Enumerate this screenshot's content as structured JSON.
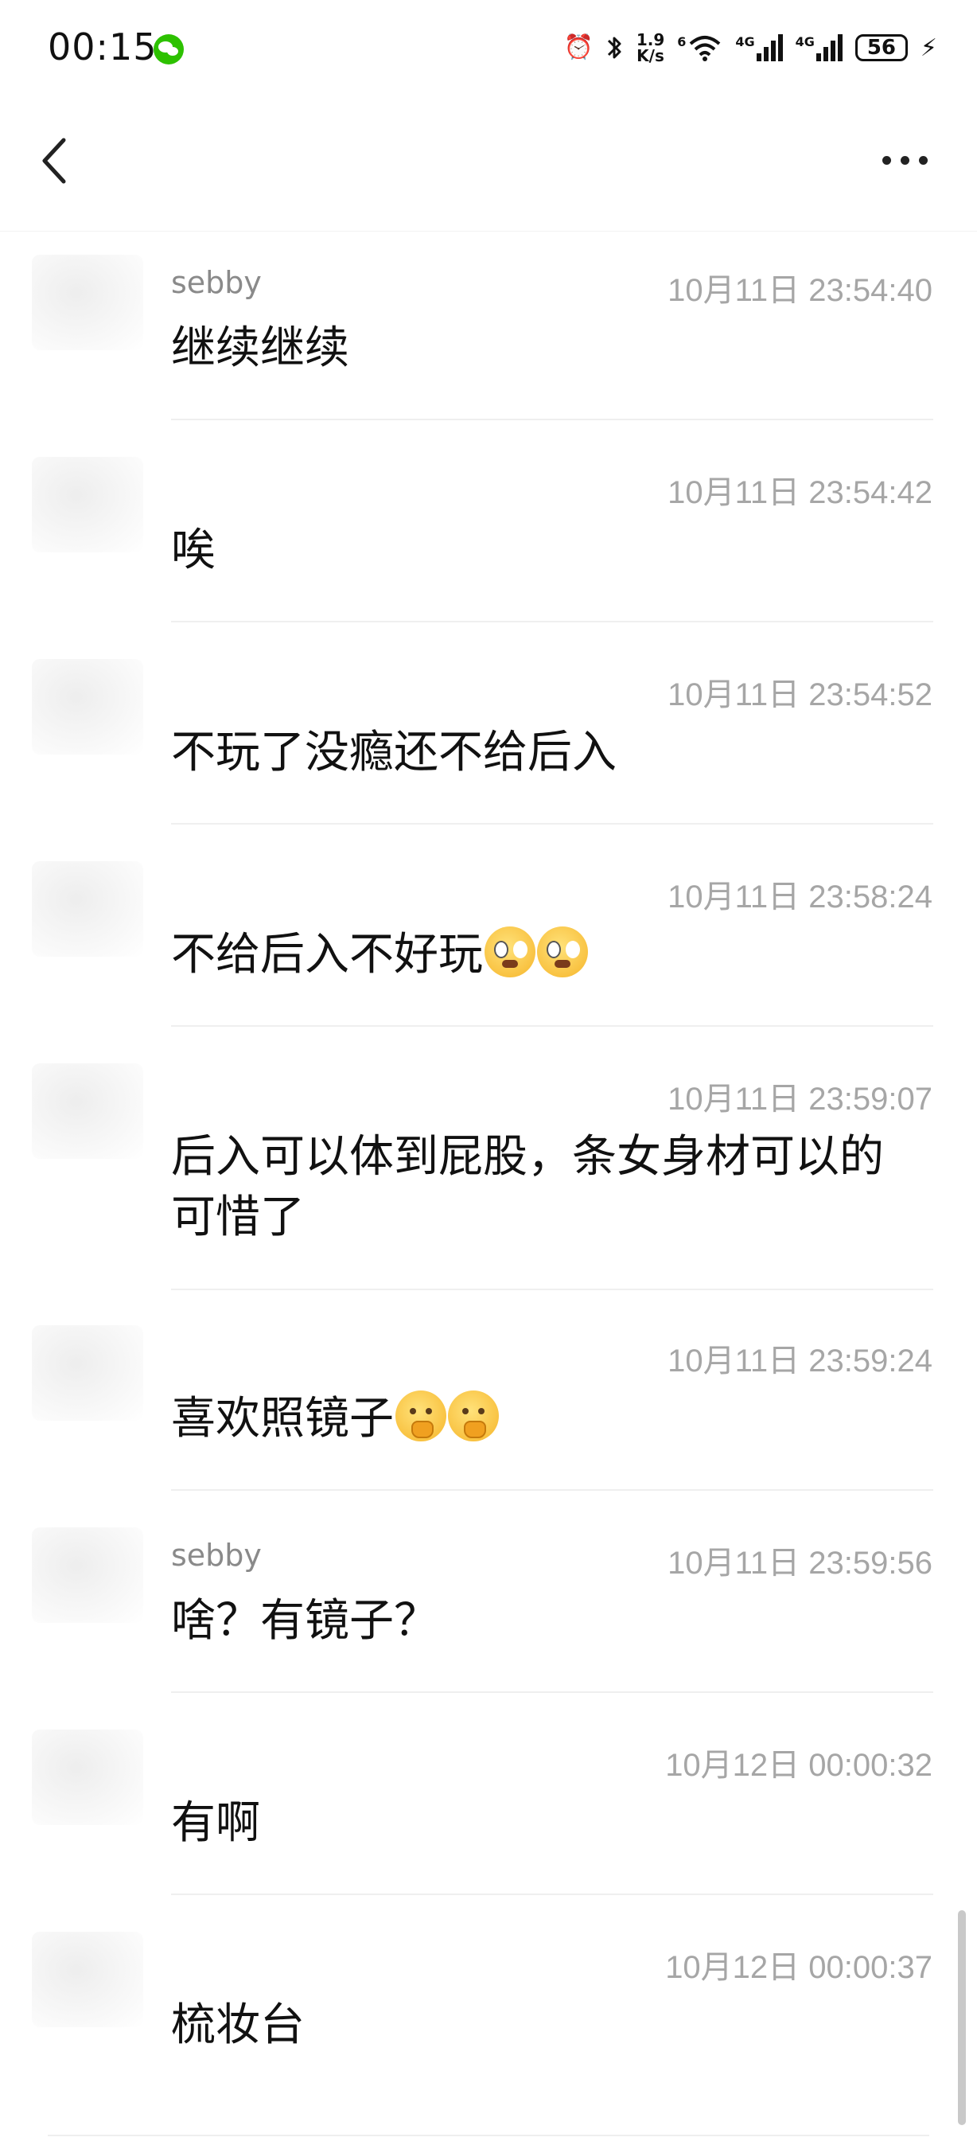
{
  "status_bar": {
    "time": "00:15",
    "net_speed_value": "1.9",
    "net_speed_unit": "K/s",
    "wifi_label": "6",
    "sim1_label": "4G",
    "sim2_label": "4G",
    "battery": "56"
  },
  "messages": [
    {
      "sender": "sebby",
      "timestamp": "10月11日 23:54:40",
      "text": "继续继续"
    },
    {
      "sender": "",
      "timestamp": "10月11日 23:54:42",
      "text": "唉"
    },
    {
      "sender": "",
      "timestamp": "10月11日 23:54:52",
      "text": "不玩了没瘾还不给后入"
    },
    {
      "sender": "",
      "timestamp": "10月11日 23:58:24",
      "text": "不给后入不好玩"
    },
    {
      "sender": "",
      "timestamp": "10月11日 23:59:07",
      "text": "后入可以体到屁股，条女身材可以的可惜了"
    },
    {
      "sender": "",
      "timestamp": "10月11日 23:59:24",
      "text": "喜欢照镜子"
    },
    {
      "sender": "sebby",
      "timestamp": "10月11日 23:59:56",
      "text": "啥？有镜子？"
    },
    {
      "sender": "",
      "timestamp": "10月12日 00:00:32",
      "text": "有啊"
    },
    {
      "sender": "",
      "timestamp": "10月12日 00:00:37",
      "text": "梳妆台"
    }
  ],
  "icons": {
    "back": "back-chevron-icon",
    "more": "more-dots-icon",
    "cry_emoji": "crying-emoji-icon",
    "think_emoji": "giggle-emoji-icon"
  }
}
